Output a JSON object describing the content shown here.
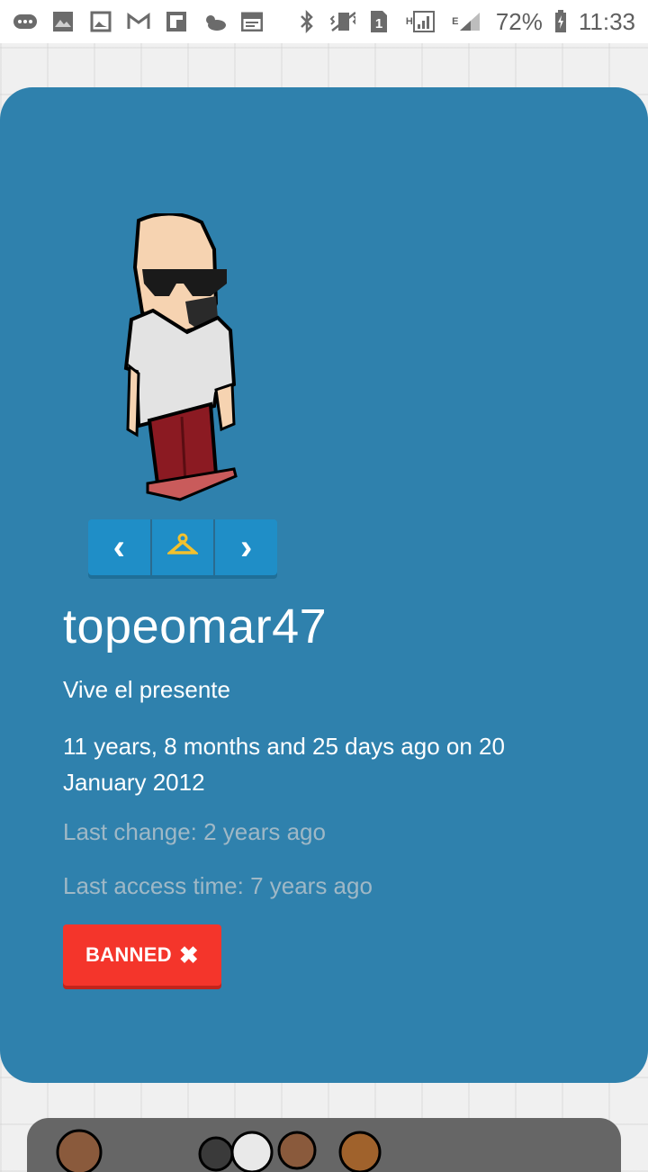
{
  "status_bar": {
    "battery": "72%",
    "time": "11:33",
    "sim_label": "1",
    "net_h": "H",
    "net_e": "E",
    "icons": [
      "chat-icon",
      "photo-icon",
      "image-icon",
      "gmail-icon",
      "flipboard-icon",
      "weather-icon",
      "calendar-icon",
      "bluetooth-icon",
      "vibrate-icon",
      "sim-icon",
      "signal-icon",
      "battery-icon"
    ]
  },
  "profile": {
    "username": "topeomar47",
    "motto": "Vive el presente",
    "member_since": "11 years, 8 months and 25 days ago on 20 January 2012",
    "last_change": "Last change: 2 years ago",
    "last_access": "Last access time: 7 years ago",
    "banned_label": "BANNED",
    "banned_icon": "✖"
  },
  "avatar_controls": {
    "prev": "‹",
    "next": "›",
    "wardrobe_icon": "hanger-icon"
  },
  "colors": {
    "card_bg": "#2f81ad",
    "banned_bg": "#f4352b",
    "control_bg": "#1f8ec7"
  }
}
